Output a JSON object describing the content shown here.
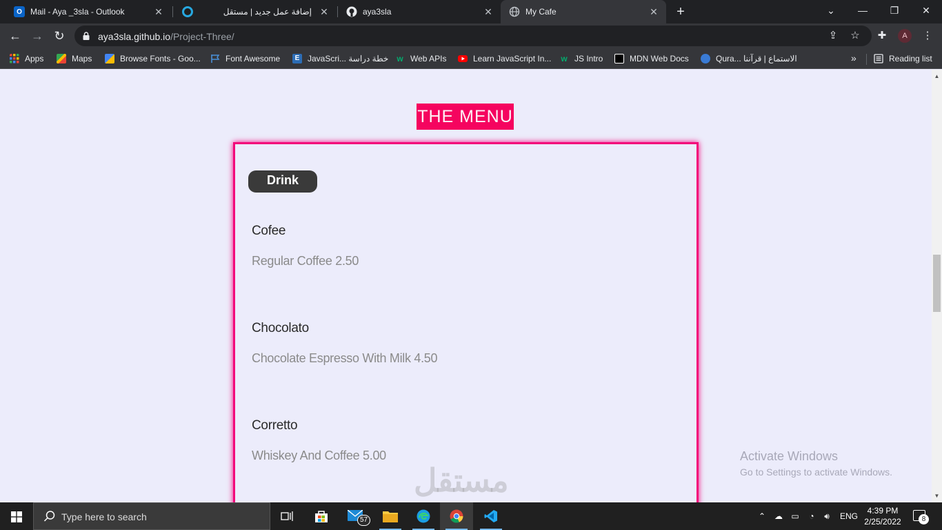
{
  "browser": {
    "tabs": [
      {
        "label": "Mail - Aya _3sla - Outlook",
        "icon": "outlook-icon",
        "active": false
      },
      {
        "label": "إضافة عمل جديد | مستقل",
        "icon": "mostaql-icon",
        "active": false
      },
      {
        "label": "aya3sla",
        "icon": "github-icon",
        "active": false
      },
      {
        "label": "My Cafe",
        "icon": "globe-icon",
        "active": true
      }
    ],
    "url_host": "aya3sla.github.io",
    "url_path": "/Project-Three/",
    "profile_initial": "A",
    "bookmarks": [
      {
        "label": "Apps",
        "icon": "apps-grid-icon"
      },
      {
        "label": "Maps",
        "icon": "maps-icon"
      },
      {
        "label": "Browse Fonts - Goo...",
        "icon": "google-fonts-icon"
      },
      {
        "label": "Font Awesome",
        "icon": "flag-icon"
      },
      {
        "label": "JavaScri... خطة دراسة",
        "icon": "elzero-icon"
      },
      {
        "label": "Web APIs",
        "icon": "w3-icon"
      },
      {
        "label": "Learn JavaScript In...",
        "icon": "youtube-icon"
      },
      {
        "label": "JS Intro",
        "icon": "w3-icon"
      },
      {
        "label": "MDN Web Docs",
        "icon": "mdn-icon"
      },
      {
        "label": "Qura... الاستماع | قرآننا",
        "icon": "quran-icon"
      }
    ],
    "more_bookmarks": "»",
    "reading_list": "Reading list"
  },
  "page": {
    "menu_title": "THE MENU",
    "section_label": "Drink",
    "items": [
      {
        "name": "Cofee",
        "desc": "Regular Coffee 2.50"
      },
      {
        "name": "Chocolato",
        "desc": "Chocolate Espresso With Milk 4.50"
      },
      {
        "name": "Corretto",
        "desc": "Whiskey And Coffee 5.00"
      }
    ],
    "activate_line1": "Activate Windows",
    "activate_line2": "Go to Settings to activate Windows.",
    "watermark": "مستقل"
  },
  "taskbar": {
    "search_placeholder": "Type here to search",
    "mail_badge": "57",
    "language": "ENG",
    "time": "4:39 PM",
    "date": "2/25/2022",
    "notification_count": "8"
  },
  "colors": {
    "accent_pink": "#f5045f",
    "badge_dark": "#3a3a3a",
    "page_bg": "#ececfb"
  }
}
